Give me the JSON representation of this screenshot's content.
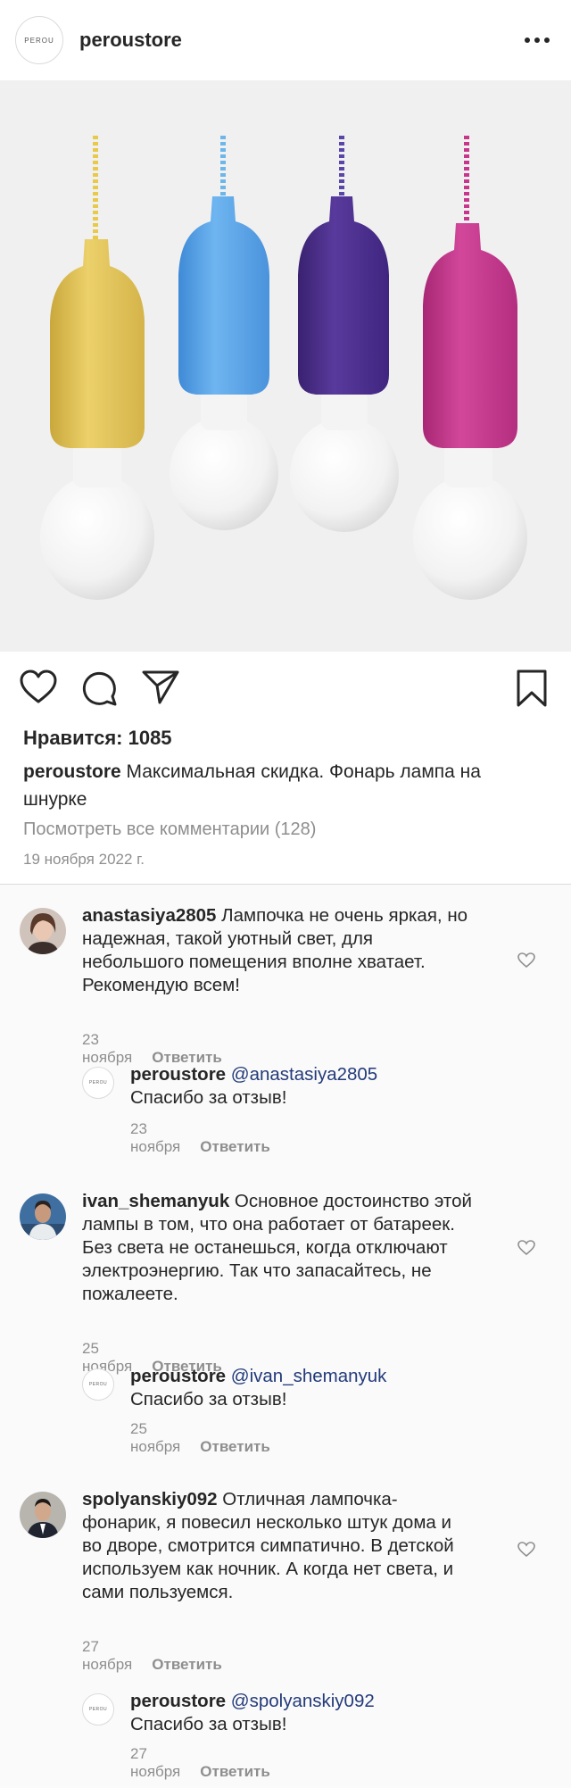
{
  "header": {
    "username": "peroustore",
    "logo_text": "PEROU",
    "more_icon": "more-horizontal-icon"
  },
  "post": {
    "image_alt": "four pull-cord lamps",
    "likes_label": "Нравится: 1085",
    "caption_user": "peroustore",
    "caption_text": " Максимальная скидка. Фонарь лампа на шнурке",
    "view_all_comments": "Посмотреть все комментарии (128)",
    "date": "19 ноября 2022 г."
  },
  "comments": [
    {
      "user": "anastasiya2805",
      "text": " Лампочка не очень яркая, но надежная, такой уютный свет, для небольшого помещения вполне хватает. Рекомендую всем!",
      "date": "23 ноября",
      "reply_label": "Ответить",
      "reply": {
        "user": "peroustore",
        "mention": "@anastasiya2805",
        "text": "Спасибо за отзыв!",
        "date": "23 ноября",
        "reply_label": "Ответить"
      }
    },
    {
      "user": "ivan_shemanyuk",
      "text": " Основное достоинство этой лампы в том, что она работает от батареек. Без света не останешься, когда отключают электроэнергию. Так что запасайтесь, не пожалеете.",
      "date": "25 ноября",
      "reply_label": "Ответить",
      "reply": {
        "user": "peroustore",
        "mention": "@ivan_shemanyuk",
        "text": "Спасибо за отзыв!",
        "date": "25 ноября",
        "reply_label": "Ответить"
      }
    },
    {
      "user": "spolyanskiy092",
      "text": " Отличная лампочка-фонарик, я повесил несколько штук дома и во дворе, смотрится симпатично. В детской используем как ночник. А когда нет света, и сами пользуемся.",
      "date": "27 ноября",
      "reply_label": "Ответить",
      "reply": {
        "user": "peroustore",
        "mention": "@spolyanskiy092",
        "text": "Спасибо за отзыв!",
        "date": "27 ноября",
        "reply_label": "Ответить"
      }
    }
  ],
  "colors": {
    "lamp_yellow": "#e4c55a",
    "lamp_blue": "#5ea6e8",
    "lamp_purple": "#4b2e8c",
    "lamp_pink": "#c8368c",
    "mention": "#233a7a"
  }
}
